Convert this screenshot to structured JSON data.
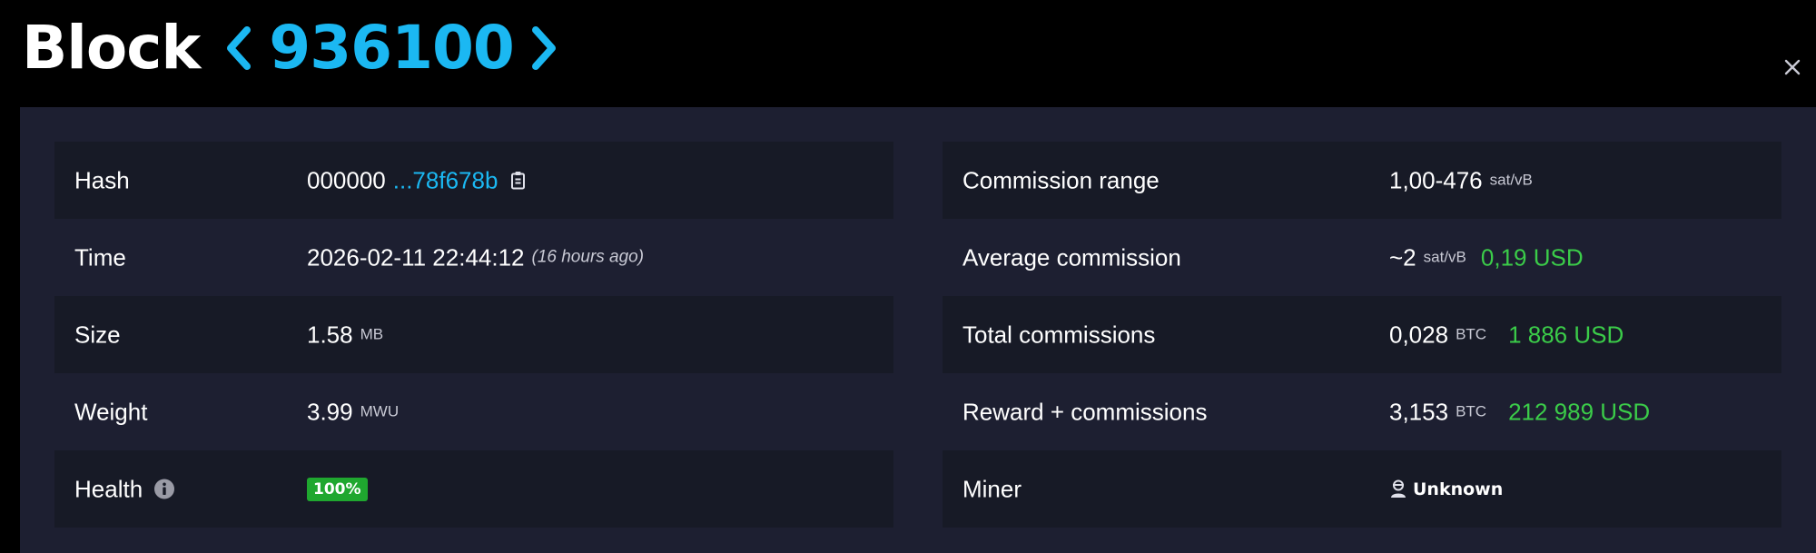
{
  "header": {
    "title_word": "Block",
    "block_height": "936100",
    "prev_icon": "chevron-left-icon",
    "next_icon": "chevron-right-icon",
    "close_icon": "close-icon"
  },
  "colors": {
    "accent": "#1bb8f2",
    "positive": "#3bcc49",
    "panel_bg": "#1d1f31",
    "row_bg": "#171a26"
  },
  "left_table": {
    "hash": {
      "label": "Hash",
      "prefix": "000000",
      "suffix": "...78f678b",
      "icon": "copy-icon"
    },
    "time": {
      "label": "Time",
      "value": "2026-02-11 22:44:12",
      "relative": "(16 hours ago)"
    },
    "size": {
      "label": "Size",
      "value": "1.58",
      "unit": "MB"
    },
    "weight": {
      "label": "Weight",
      "value": "3.99",
      "unit": "MWU"
    },
    "health": {
      "label": "Health",
      "icon": "info-icon",
      "value": "100%"
    }
  },
  "right_table": {
    "commission_range": {
      "label": "Commission range",
      "value": "1,00-476",
      "unit": "sat/vB"
    },
    "average_commission": {
      "label": "Average commission",
      "value": "~2",
      "unit": "sat/vB",
      "usd": "0,19 USD"
    },
    "total_commissions": {
      "label": "Total commissions",
      "value": "0,028",
      "unit": "BTC",
      "usd": "1 886 USD"
    },
    "reward_commissions": {
      "label": "Reward + commissions",
      "value": "3,153",
      "unit": "BTC",
      "usd": "212 989 USD"
    },
    "miner": {
      "label": "Miner",
      "icon": "user-icon",
      "value": "Unknown"
    }
  }
}
